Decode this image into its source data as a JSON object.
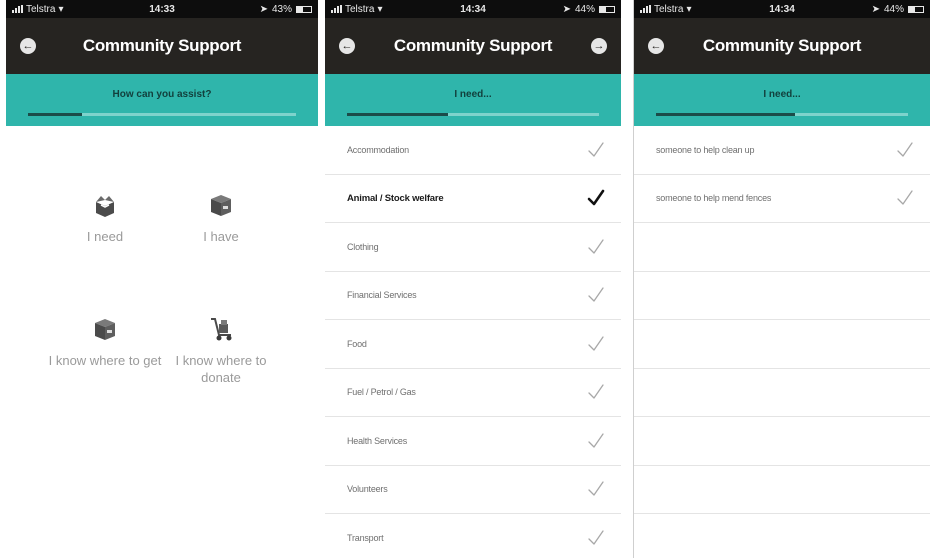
{
  "phones": [
    {
      "status": {
        "carrier": "Telstra",
        "time": "14:33",
        "battery": "43%",
        "battery_level": 0.43
      },
      "nav": {
        "title": "Community Support",
        "back_icon": "back-arrow-icon"
      },
      "prompt": {
        "text": "How can you assist?",
        "progress": 0.2
      },
      "tiles": [
        {
          "label": "I need",
          "icon": "open-box-icon"
        },
        {
          "label": "I have",
          "icon": "closed-box-icon"
        },
        {
          "label": "I know where to get",
          "icon": "closed-box-icon"
        },
        {
          "label": "I know where to donate",
          "icon": "hand-truck-icon"
        }
      ]
    },
    {
      "status": {
        "carrier": "Telstra",
        "time": "14:34",
        "battery": "44%",
        "battery_level": 0.44
      },
      "nav": {
        "title": "Community Support",
        "back_icon": "back-arrow-icon",
        "forward_icon": "forward-arrow-icon"
      },
      "prompt": {
        "text": "I need...",
        "progress": 0.4
      },
      "items": [
        {
          "label": "Accommodation",
          "selected": false
        },
        {
          "label": "Animal / Stock welfare",
          "selected": true
        },
        {
          "label": "Clothing",
          "selected": false
        },
        {
          "label": "Financial Services",
          "selected": false
        },
        {
          "label": "Food",
          "selected": false
        },
        {
          "label": "Fuel / Petrol / Gas",
          "selected": false
        },
        {
          "label": "Health Services",
          "selected": false
        },
        {
          "label": "Volunteers",
          "selected": false
        },
        {
          "label": "Transport",
          "selected": false
        }
      ]
    },
    {
      "status": {
        "carrier": "Telstra",
        "time": "14:34",
        "battery": "44%",
        "battery_level": 0.44
      },
      "nav": {
        "title": "Community Support",
        "back_icon": "back-arrow-icon"
      },
      "prompt": {
        "text": "I need...",
        "progress": 0.55
      },
      "items": [
        {
          "label": "someone to help clean up",
          "selected": false
        },
        {
          "label": "someone to help mend fences",
          "selected": false
        },
        {
          "label": "",
          "selected": false
        },
        {
          "label": "",
          "selected": false
        },
        {
          "label": "",
          "selected": false
        },
        {
          "label": "",
          "selected": false
        },
        {
          "label": "",
          "selected": false
        },
        {
          "label": "",
          "selected": false
        }
      ]
    }
  ],
  "colors": {
    "navbar": "#262421",
    "accent": "#2fb5ab",
    "progress_done": "#1b4c49",
    "check_inactive": "#a8a8a8",
    "check_active": "#111111"
  }
}
